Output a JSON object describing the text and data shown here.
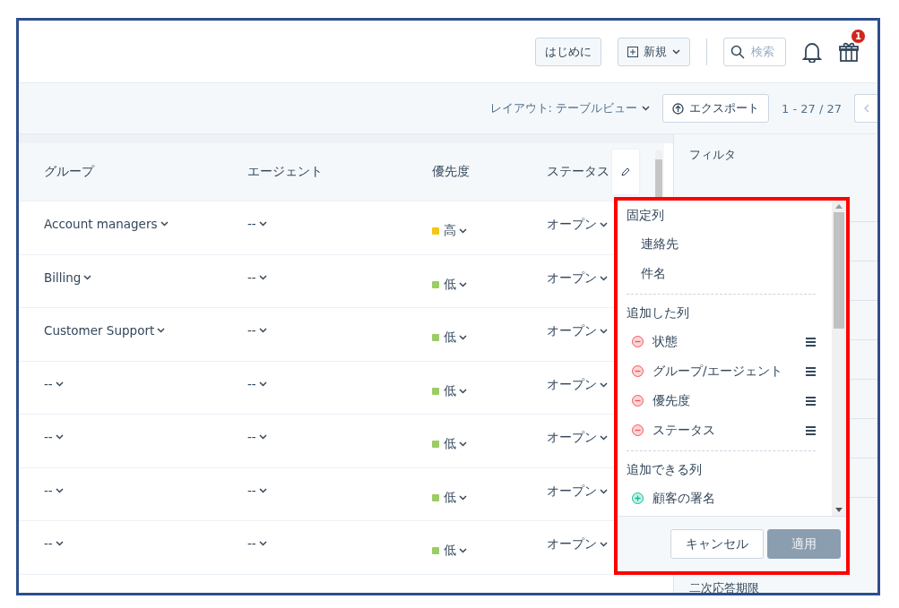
{
  "header": {
    "buttons": [
      {
        "kind": "plain",
        "label": "はじめに"
      },
      {
        "kind": "new",
        "label": "新規"
      }
    ],
    "search": {
      "placeholder": "検索"
    },
    "notification_badge": "1"
  },
  "toolbar": {
    "layout": "レイアウト: テーブルビュー",
    "export": "エクスポート",
    "pagination": "1 - 27 / 27"
  },
  "table": {
    "columns": [
      "グループ",
      "エージェント",
      "優先度",
      "ステータス"
    ],
    "rows": [
      {
        "group": "Account managers",
        "agent": "--",
        "priority": {
          "label": "高",
          "color": "#f5c518"
        },
        "status": "オープン"
      },
      {
        "group": "Billing",
        "agent": "--",
        "priority": {
          "label": "低",
          "color": "#9ccc65"
        },
        "status": "オープン"
      },
      {
        "group": "Customer Support",
        "agent": "--",
        "priority": {
          "label": "低",
          "color": "#9ccc65"
        },
        "status": "オープン"
      },
      {
        "group": "--",
        "agent": "--",
        "priority": {
          "label": "低",
          "color": "#9ccc65"
        },
        "status": "オープン"
      },
      {
        "group": "--",
        "agent": "--",
        "priority": {
          "label": "低",
          "color": "#9ccc65"
        },
        "status": "オープン"
      },
      {
        "group": "--",
        "agent": "--",
        "priority": {
          "label": "低",
          "color": "#9ccc65"
        },
        "status": "オープン"
      },
      {
        "group": "--",
        "agent": "--",
        "priority": {
          "label": "低",
          "color": "#9ccc65"
        },
        "status": "オープン"
      }
    ]
  },
  "filter_panel": {
    "title": "フィルタ",
    "labels": [
      "二次応答期限"
    ]
  },
  "column_popup": {
    "sections": [
      {
        "title": "固定列",
        "kind": "fixed",
        "items": [
          "連絡先",
          "件名"
        ]
      },
      {
        "title": "追加した列",
        "kind": "added",
        "items": [
          "状態",
          "グループ/エージェント",
          "優先度",
          "ステータス"
        ]
      },
      {
        "title": "追加できる列",
        "kind": "available",
        "items": [
          "顧客の署名"
        ]
      }
    ],
    "cancel": "キャンセル",
    "apply": "適用"
  }
}
